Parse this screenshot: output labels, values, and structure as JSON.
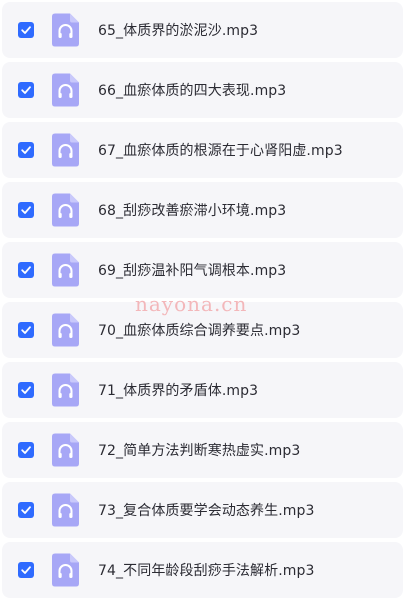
{
  "colors": {
    "checkbox": "#2f6bff",
    "file_icon": "#a7a7f6",
    "row_background": "#f6f6f9",
    "watermark": "#f3b7ba"
  },
  "file_icon_name": "headphones-audio-file-icon",
  "files": [
    {
      "name": "65_体质界的淤泥沙.mp3",
      "checked": true
    },
    {
      "name": "66_血瘀体质的四大表现.mp3",
      "checked": true
    },
    {
      "name": "67_血瘀体质的根源在于心肾阳虚.mp3",
      "checked": true
    },
    {
      "name": "68_刮痧改善瘀滞小环境.mp3",
      "checked": true
    },
    {
      "name": "69_刮痧温补阳气调根本.mp3",
      "checked": true
    },
    {
      "name": "70_血瘀体质综合调养要点.mp3",
      "checked": true
    },
    {
      "name": "71_体质界的矛盾体.mp3",
      "checked": true
    },
    {
      "name": "72_简单方法判断寒热虚实.mp3",
      "checked": true
    },
    {
      "name": "73_复合体质要学会动态养生.mp3",
      "checked": true
    },
    {
      "name": "74_不同年龄段刮痧手法解析.mp3",
      "checked": true
    }
  ],
  "watermark": "nayona.cn"
}
